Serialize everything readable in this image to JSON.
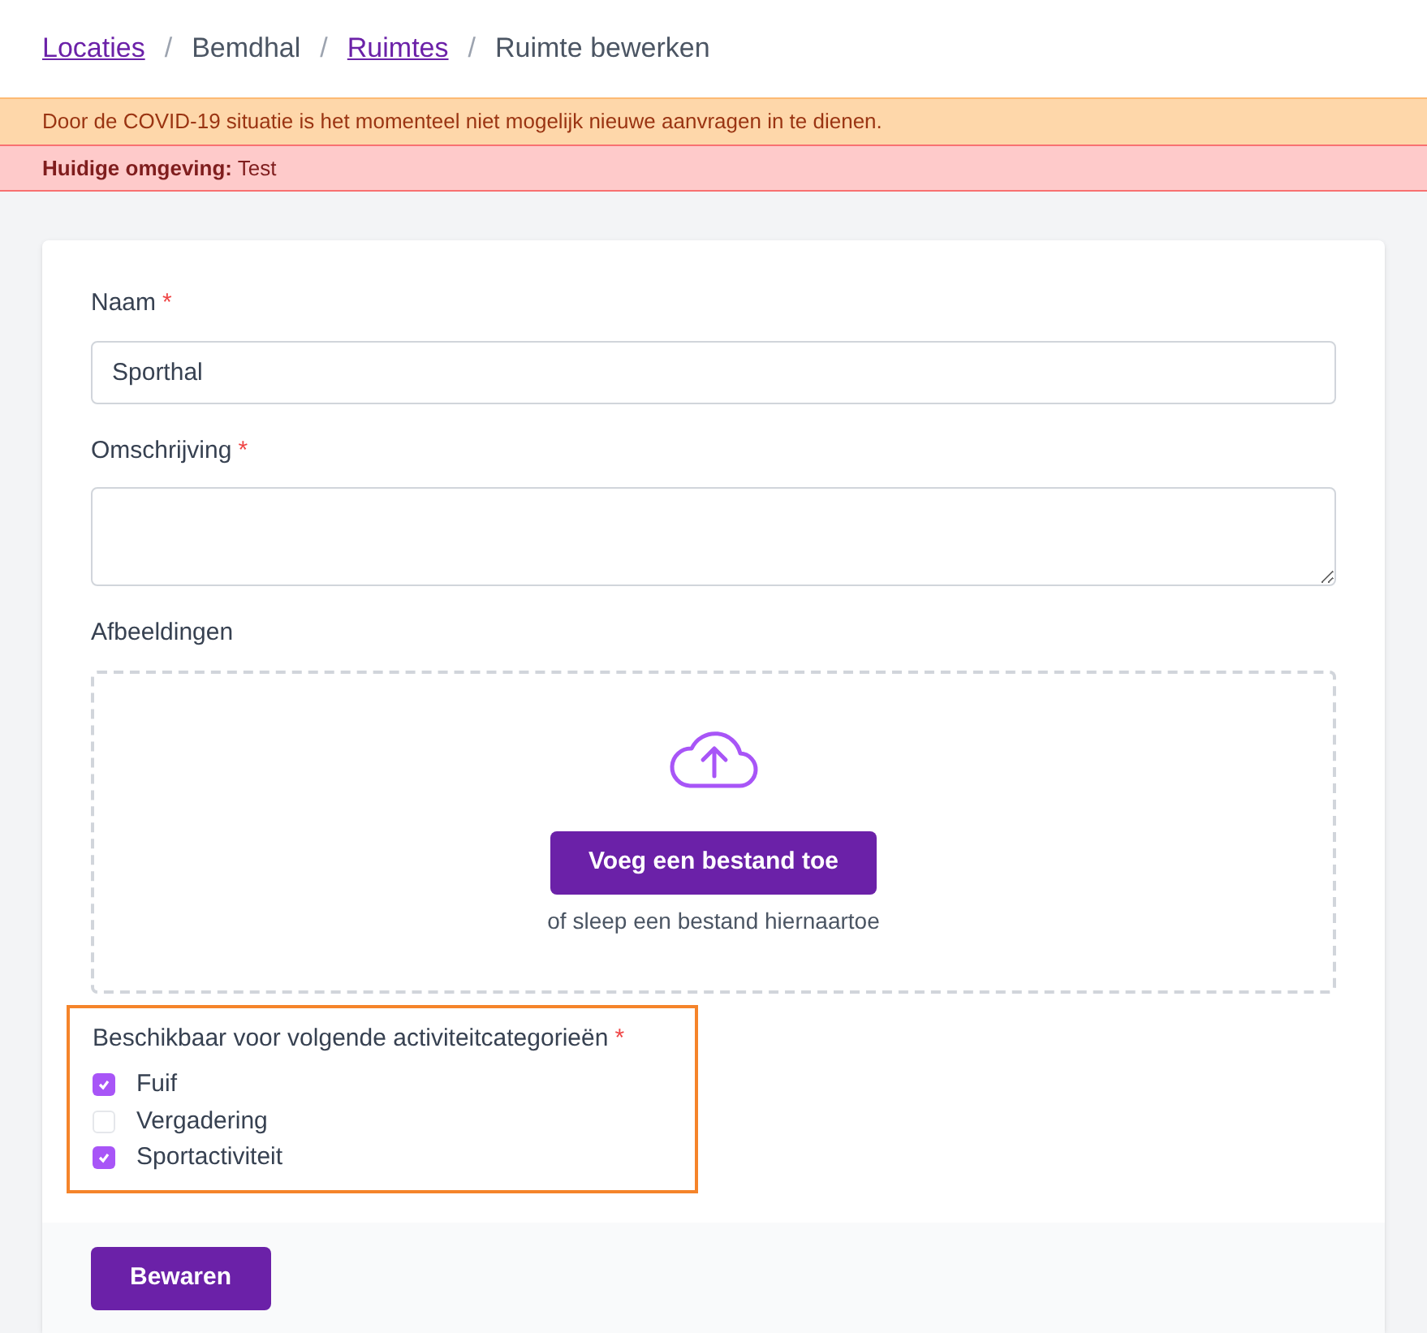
{
  "breadcrumb": [
    {
      "label": "Locaties",
      "kind": "link"
    },
    {
      "label": "Bemdhal",
      "kind": "text"
    },
    {
      "label": "Ruimtes",
      "kind": "link"
    },
    {
      "label": "Ruimte bewerken",
      "kind": "text"
    }
  ],
  "breadcrumb_separator": "/",
  "banners": [
    {
      "kind": "warning",
      "text": "Door de COVID-19 situatie is het momenteel niet mogelijk nieuwe aanvragen in te dienen."
    },
    {
      "kind": "danger",
      "text": "**Huidige omgeving:** Test"
    }
  ],
  "form": {
    "name": {
      "label": "Naam",
      "required": "*",
      "value": "Sporthal"
    },
    "description": {
      "label": "Omschrijving",
      "required": "*"
    },
    "images": {
      "label": "Afbeeldingen",
      "button": "Voeg een bestand toe",
      "hint": "of sleep een bestand hiernaartoe"
    },
    "categories": {
      "label": "Beschikbaar voor volgende activiteitcategorieën",
      "required": "*",
      "highlighted": true,
      "options": [
        {
          "label": "Fuif",
          "checked": true
        },
        {
          "label": "Vergadering",
          "checked": false
        },
        {
          "label": "Sportactiviteit",
          "checked": true
        }
      ]
    },
    "submit": "Bewaren"
  }
}
